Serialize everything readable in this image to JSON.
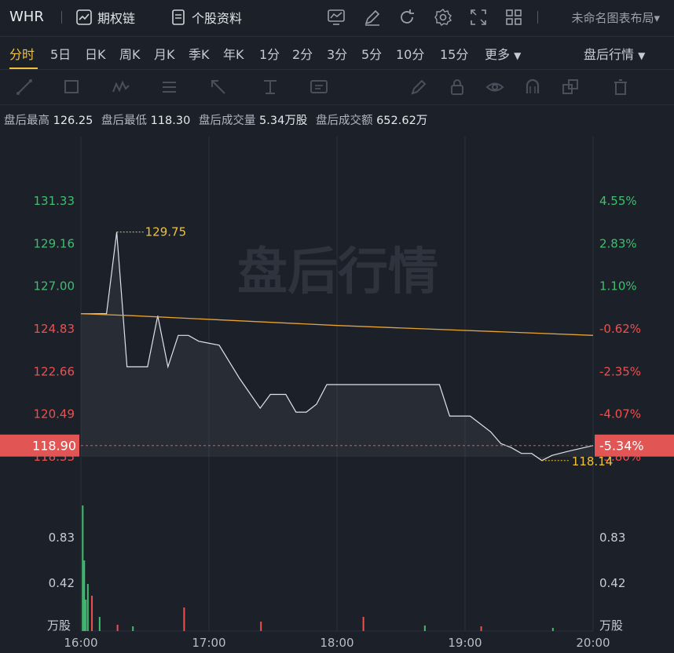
{
  "header": {
    "ticker": "WHR",
    "options_chain": "期权链",
    "stock_info": "个股资料",
    "layout_name": "未命名图表布局"
  },
  "tabs": [
    "分时",
    "5日",
    "日K",
    "周K",
    "月K",
    "季K",
    "年K",
    "1分",
    "2分",
    "3分",
    "5分",
    "10分",
    "15分",
    "更多"
  ],
  "active_tab": "分时",
  "session_select": "盘后行情",
  "info": {
    "high_label": "盘后最高",
    "high": "126.25",
    "low_label": "盘后最低",
    "low": "118.30",
    "vol_label": "盘后成交量",
    "vol": "5.34万股",
    "amt_label": "盘后成交额",
    "amt": "652.62万"
  },
  "chart_data": {
    "type": "line",
    "watermark": "盘后行情",
    "x_ticks": [
      "16:00",
      "17:00",
      "18:00",
      "19:00",
      "20:00"
    ],
    "price_ticks": [
      "131.33",
      "129.16",
      "127.00",
      "124.83",
      "122.66",
      "120.49",
      "118.33"
    ],
    "pct_ticks": [
      "4.55%",
      "2.83%",
      "1.10%",
      "-0.62%",
      "-2.35%",
      "-4.07%",
      "-5.80%"
    ],
    "ylim": [
      118.33,
      131.33
    ],
    "current_price": "118.90",
    "current_pct": "-5.34%",
    "max_label": "129.75",
    "min_label": "118.14",
    "vol_ticks": [
      "0.83",
      "0.42"
    ],
    "vol_unit": "万股",
    "price_series": [
      [
        0,
        125.6
      ],
      [
        0.05,
        125.6
      ],
      [
        0.07,
        129.75
      ],
      [
        0.09,
        122.9
      ],
      [
        0.13,
        122.9
      ],
      [
        0.15,
        125.5
      ],
      [
        0.17,
        122.9
      ],
      [
        0.19,
        124.5
      ],
      [
        0.21,
        124.5
      ],
      [
        0.23,
        124.2
      ],
      [
        0.27,
        124.0
      ],
      [
        0.31,
        122.3
      ],
      [
        0.35,
        120.8
      ],
      [
        0.37,
        121.5
      ],
      [
        0.4,
        121.5
      ],
      [
        0.42,
        120.6
      ],
      [
        0.44,
        120.6
      ],
      [
        0.46,
        121.0
      ],
      [
        0.48,
        122.0
      ],
      [
        0.55,
        122.0
      ],
      [
        0.62,
        122.0
      ],
      [
        0.7,
        122.0
      ],
      [
        0.72,
        120.4
      ],
      [
        0.76,
        120.4
      ],
      [
        0.8,
        119.6
      ],
      [
        0.82,
        119.0
      ],
      [
        0.84,
        118.8
      ],
      [
        0.86,
        118.5
      ],
      [
        0.88,
        118.5
      ],
      [
        0.9,
        118.14
      ],
      [
        0.92,
        118.4
      ],
      [
        0.95,
        118.6
      ],
      [
        1.0,
        118.9
      ]
    ],
    "avg_series": [
      [
        0,
        125.6
      ],
      [
        0.1,
        125.5
      ],
      [
        0.5,
        125.0
      ],
      [
        1.0,
        124.5
      ]
    ]
  }
}
